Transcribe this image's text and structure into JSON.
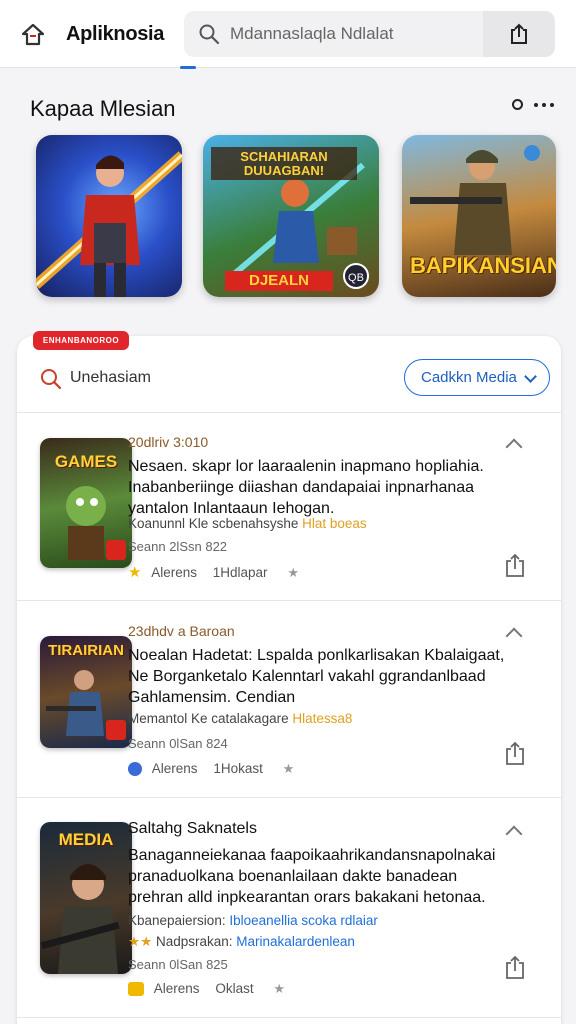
{
  "header": {
    "app_title": "Apliknosia",
    "search_placeholder": "Mdannaslaqla Ndlalat"
  },
  "featured": {
    "title": "Kapaa Mlesian",
    "tiles": [
      {
        "caption": ""
      },
      {
        "banner": "SCHAHIARAN DUUAGBAN!",
        "bottom": "DJEALN",
        "badge": "QB"
      },
      {
        "caption": "BAPIKANSIAN"
      }
    ]
  },
  "list_header": {
    "tag": "ENHANBANOROO",
    "filter_label": "Unehasiam",
    "media_button": "Cadkkn Media"
  },
  "items": [
    {
      "thumb_label": "GAMES",
      "date": "20dlriv 3:010",
      "headline": "Nesaen. skapr lor laaraalenin inapmano hopliahia. Inabanberiinge diiashan dandapaiai inpnarhanaa yantalon Inlantaaun Iehogan.",
      "byline_main": "Koanunnl Kle scbenahsyshe",
      "byline_hl": "Hlat boeas",
      "meta": "Seann 2lSsn 822",
      "foot_author": "Alerens",
      "foot_time": "1Hdlapar"
    },
    {
      "thumb_label": "TIRAIRIAN",
      "date": "23dhdv a Baroan",
      "headline": "Noealan Hadetat: Lspalda ponlkarlisakan Kbalaigaat, Ne Borganketalo Kalenntarl vakahl ggrandanlbaad Gahlamensim. Cendian",
      "byline_main": "Memantol Ke catalakagare",
      "byline_hl": "Hlatessa8",
      "meta": "Seann 0lSan 824",
      "foot_author": "Alerens",
      "foot_time": "1Hokast"
    },
    {
      "thumb_label": "MEDIA",
      "date": "Saltahg Saknatels",
      "headline": "Banaganneiekanaa faapoikaahrikandansnapolnakai pranaduolkana boenanlailaan dakte banadean prehran alld inpkearantan orars bakakani hetonaa.",
      "byline_main": "Kbanepaiersion:",
      "byline_blue": "Ibloeanellia scoka rdlaiar",
      "byline2_main": "Nadpsrakan:",
      "byline2_blue": "Marinakalardenlean",
      "meta": "Seann 0lSan 825",
      "foot_author": "Alerens",
      "foot_time": "Oklast"
    }
  ],
  "colors": {
    "accent": "#1e6fd9",
    "tag_red": "#e0252b",
    "highlight": "#e0a020"
  }
}
